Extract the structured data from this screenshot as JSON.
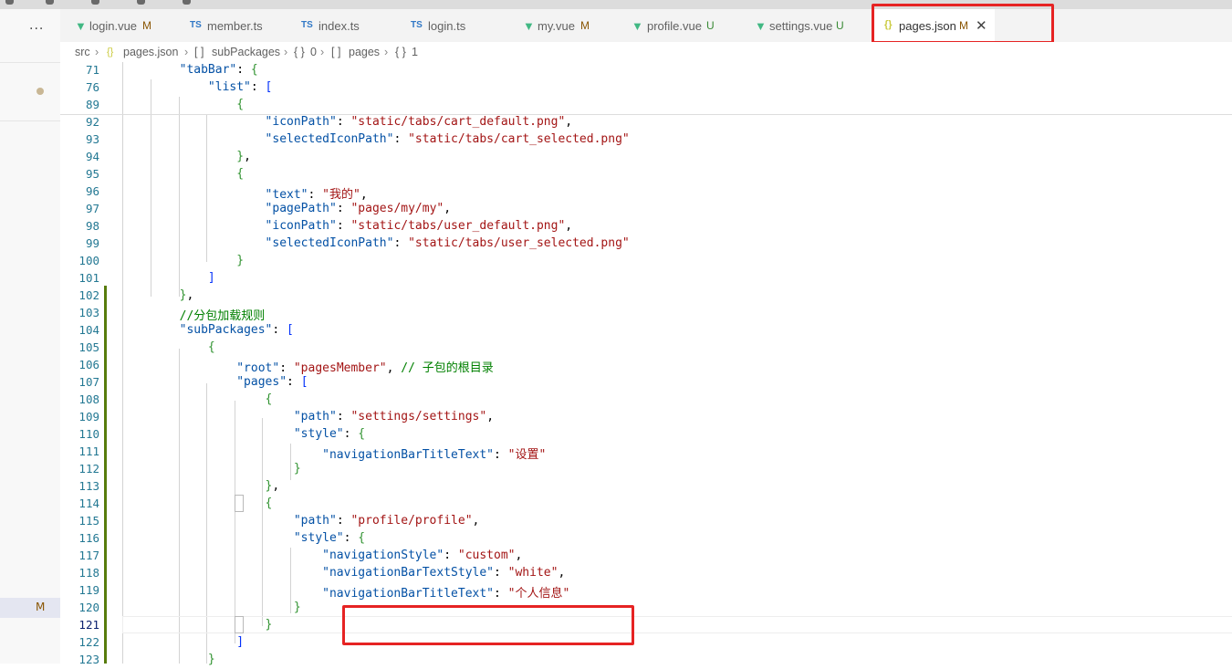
{
  "activity": {
    "more_label": "···",
    "m_badge": "M"
  },
  "tabs": [
    {
      "icon": "vue-icon",
      "name": "login.vue",
      "status": "M",
      "active": false
    },
    {
      "icon": "ts-icon",
      "name": "member.ts",
      "status": "",
      "active": false
    },
    {
      "icon": "ts-icon",
      "name": "index.ts",
      "status": "",
      "active": false
    },
    {
      "icon": "ts-icon",
      "name": "login.ts",
      "status": "",
      "active": false
    },
    {
      "icon": "vue-icon",
      "name": "my.vue",
      "status": "M",
      "active": false
    },
    {
      "icon": "vue-icon",
      "name": "profile.vue",
      "status": "U",
      "active": false
    },
    {
      "icon": "vue-icon",
      "name": "settings.vue",
      "status": "U",
      "active": false
    },
    {
      "icon": "json-icon",
      "name": "pages.json",
      "status": "M",
      "active": true
    }
  ],
  "icon_glyphs": {
    "ts": "TS",
    "json": "{}",
    "close": "✕"
  },
  "breadcrumb": [
    "src",
    "pages.json",
    "subPackages",
    "0",
    "pages",
    "1"
  ],
  "colors": {
    "highlight": "#e62323",
    "vue": "#41b883",
    "ts": "#3178c6",
    "json": "#cbcb41",
    "modified": "#895503",
    "untracked": "#388a34"
  },
  "code_lines": [
    {
      "n": "71",
      "text": "        \"tabBar\": {"
    },
    {
      "n": "76",
      "text": "            \"list\": ["
    },
    {
      "n": "89",
      "text": "                {"
    },
    {
      "n": "92",
      "text": "                    \"iconPath\": \"static/tabs/cart_default.png\","
    },
    {
      "n": "93",
      "text": "                    \"selectedIconPath\": \"static/tabs/cart_selected.png\""
    },
    {
      "n": "94",
      "text": "                },"
    },
    {
      "n": "95",
      "text": "                {"
    },
    {
      "n": "96",
      "text": "                    \"text\": \"我的\","
    },
    {
      "n": "97",
      "text": "                    \"pagePath\": \"pages/my/my\","
    },
    {
      "n": "98",
      "text": "                    \"iconPath\": \"static/tabs/user_default.png\","
    },
    {
      "n": "99",
      "text": "                    \"selectedIconPath\": \"static/tabs/user_selected.png\""
    },
    {
      "n": "100",
      "text": "                }"
    },
    {
      "n": "101",
      "text": "            ]"
    },
    {
      "n": "102",
      "text": "        },"
    },
    {
      "n": "103",
      "text": "        //分包加载规则"
    },
    {
      "n": "104",
      "text": "        \"subPackages\": ["
    },
    {
      "n": "105",
      "text": "            {"
    },
    {
      "n": "106",
      "text": "                \"root\": \"pagesMember\", // 子包的根目录"
    },
    {
      "n": "107",
      "text": "                \"pages\": ["
    },
    {
      "n": "108",
      "text": "                    {"
    },
    {
      "n": "109",
      "text": "                        \"path\": \"settings/settings\","
    },
    {
      "n": "110",
      "text": "                        \"style\": {"
    },
    {
      "n": "111",
      "text": "                            \"navigationBarTitleText\": \"设置\""
    },
    {
      "n": "112",
      "text": "                        }"
    },
    {
      "n": "113",
      "text": "                    },"
    },
    {
      "n": "114",
      "text": "                    {"
    },
    {
      "n": "115",
      "text": "                        \"path\": \"profile/profile\","
    },
    {
      "n": "116",
      "text": "                        \"style\": {"
    },
    {
      "n": "117",
      "text": "                            \"navigationStyle\": \"custom\","
    },
    {
      "n": "118",
      "text": "                            \"navigationBarTextStyle\": \"white\","
    },
    {
      "n": "119",
      "text": "                            \"navigationBarTitleText\": \"个人信息\""
    },
    {
      "n": "120",
      "text": "                        }"
    },
    {
      "n": "121",
      "text": "                    }"
    },
    {
      "n": "122",
      "text": "                ]"
    },
    {
      "n": "123",
      "text": "            }"
    }
  ]
}
